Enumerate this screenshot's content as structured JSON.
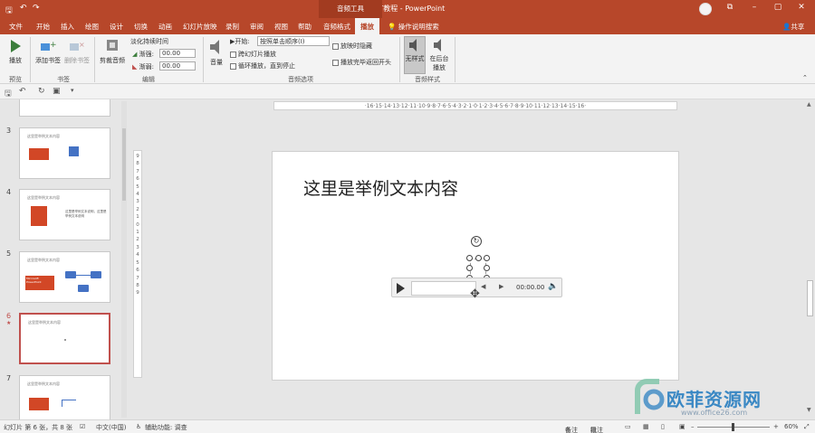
{
  "titlebar": {
    "title": "PPT教程 - PowerPoint",
    "context_tab": "音频工具"
  },
  "tabs": [
    {
      "label": "文件"
    },
    {
      "label": "开始"
    },
    {
      "label": "插入"
    },
    {
      "label": "绘图"
    },
    {
      "label": "设计"
    },
    {
      "label": "切换"
    },
    {
      "label": "动画"
    },
    {
      "label": "幻灯片放映"
    },
    {
      "label": "录制"
    },
    {
      "label": "审阅"
    },
    {
      "label": "视图"
    },
    {
      "label": "帮助"
    },
    {
      "label": "音频格式"
    },
    {
      "label": "播放"
    }
  ],
  "help_search": "操作说明搜索",
  "share": "共享",
  "ribbon": {
    "play_label": "播放",
    "add_bookmark": "添加书签",
    "remove_bookmark": "删除书签",
    "trim_audio": "剪裁音频",
    "fade_duration_title": "淡化持续时间",
    "fade_in_label": "渐强:",
    "fade_in_value": "00.00",
    "fade_out_label": "渐弱:",
    "fade_out_value": "00.00",
    "volume_label": "音量",
    "start_label": "开始:",
    "start_value": "按照单击顺序(I)",
    "cross_slides": "跨幻灯片播放",
    "loop_until_stop": "循环播放，直到停止",
    "hide_during_show": "放映时隐藏",
    "rewind_after_play": "播放完毕返回开头",
    "no_style": "无样式",
    "play_in_background": "在后台播放",
    "groups": {
      "preview": "预览",
      "bookmarks": "书签",
      "editing": "编辑",
      "audio_options": "音频选项",
      "audio_styles": "音频样式"
    }
  },
  "thumbnails": [
    {
      "number": "3",
      "title": "这里是举例文本内容"
    },
    {
      "number": "4",
      "title": "这里是举例文本内容",
      "body": "这里是举例文本说明，这里是举例文本说明"
    },
    {
      "number": "5",
      "title": "这里是举例文本内容",
      "box": "Microsoft PowerPoint"
    },
    {
      "number": "6",
      "title": "这里是举例文本内容",
      "star": "★"
    },
    {
      "number": "7",
      "title": "这里是举例文本内容"
    }
  ],
  "ruler_h": "·16·15·14·13·12·11·10·9·8·7·6·5·4·3·2·1·0·1·2·3·4·5·6·7·8·9·10·11·12·13·14·15·16·",
  "ruler_v": "9 8 7 6 5 4 3 2 1 0 1 2 3 4 5 6 7 8 9",
  "slide": {
    "title": "这里是举例文本内容",
    "player_time": "00:00.00"
  },
  "status": {
    "slide_info": "幻灯片 第 6 张，共 8 张",
    "language": "中文(中国)",
    "accessibility": "辅助功能: 调查",
    "notes": "备注",
    "comments": "批注",
    "zoom": "60%"
  },
  "watermark": {
    "name": "欧菲资源网",
    "url": "www.office26.com"
  },
  "colors": {
    "accent": "#b7472a",
    "selected_thumb": "#c0504d",
    "watermark": "#3a88c4"
  }
}
